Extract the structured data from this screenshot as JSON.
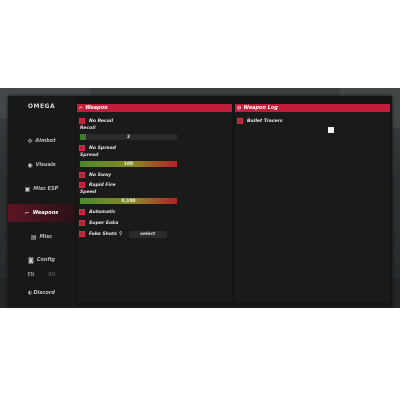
{
  "app": {
    "logo": "OMEGA"
  },
  "sidebar": {
    "items": [
      {
        "label": "Aimbot",
        "icon": "crosshair-icon"
      },
      {
        "label": "Visuals",
        "icon": "eye-icon"
      },
      {
        "label": "Misc ESP",
        "icon": "esp-icon"
      },
      {
        "label": "Weapons",
        "icon": "gun-icon"
      },
      {
        "label": "Misc",
        "icon": "misc-icon"
      },
      {
        "label": "Config",
        "icon": "save-icon"
      }
    ],
    "active_index": 3,
    "lang": {
      "primary": "EN",
      "secondary": "RU"
    },
    "discord_label": "Discord"
  },
  "weapon_section": {
    "title": "Weapon",
    "no_recoil": {
      "label": "No Recoil",
      "checked": true
    },
    "recoil_label": "Recoil",
    "recoil_value": "2",
    "no_spread": {
      "label": "No Spread",
      "checked": true
    },
    "spread_label": "Spread",
    "spread_value": "100",
    "no_sway": {
      "label": "No Sway",
      "checked": true
    },
    "rapid_fire": {
      "label": "Rapid Fire",
      "checked": true
    },
    "speed_label": "Speed",
    "speed_value": "0,100",
    "automatic": {
      "label": "Automatic",
      "checked": true
    },
    "super_eoka": {
      "label": "Super Eoka",
      "checked": true
    },
    "fake_shots": {
      "label": "Fake Shots",
      "checked": true
    },
    "fake_shots_select": "select"
  },
  "weapon_log_section": {
    "title": "Weapon Log",
    "bullet_tracers": {
      "label": "Bullet Tracers",
      "checked": true
    }
  },
  "colors": {
    "accent": "#c21d3a",
    "active_tab": "#5b1422",
    "panel_bg": "#141414"
  }
}
